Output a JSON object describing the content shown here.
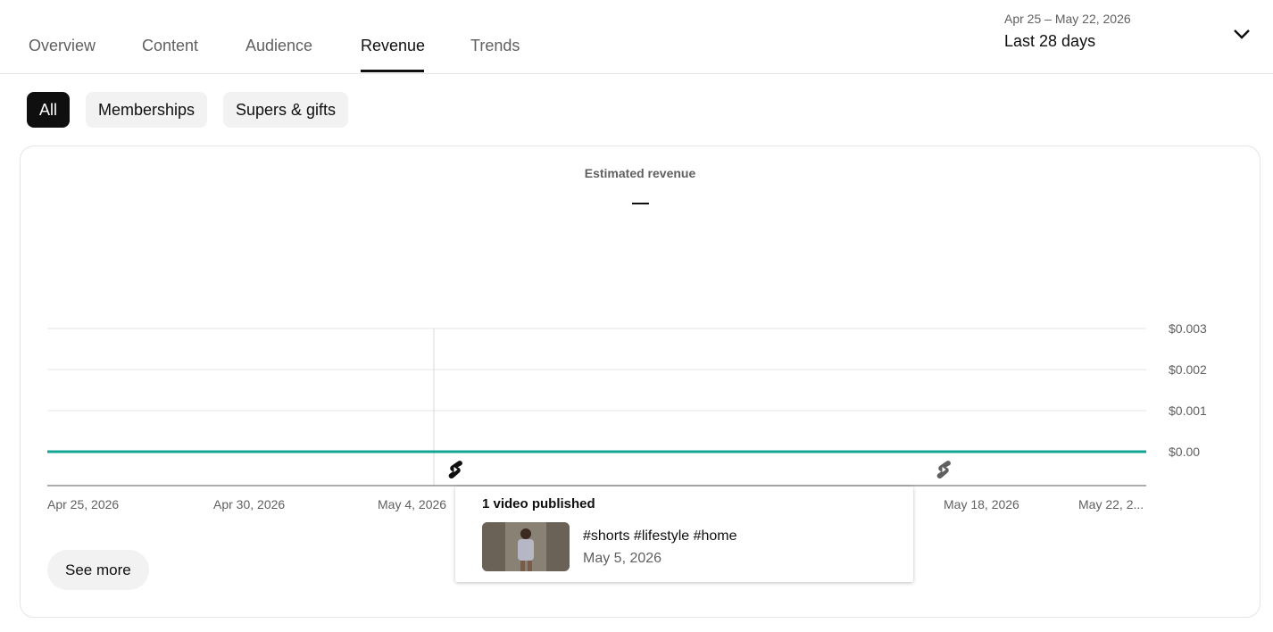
{
  "tabs": [
    {
      "label": "Overview",
      "active": false
    },
    {
      "label": "Content",
      "active": false
    },
    {
      "label": "Audience",
      "active": false
    },
    {
      "label": "Revenue",
      "active": true
    },
    {
      "label": "Trends",
      "active": false
    }
  ],
  "date_picker": {
    "range": "Apr 25 – May 22, 2026",
    "label": "Last 28 days",
    "icon": "chevron-down-icon"
  },
  "filter_chips": [
    {
      "label": "All",
      "selected": true
    },
    {
      "label": "Memberships",
      "selected": false
    },
    {
      "label": "Supers & gifts",
      "selected": false
    }
  ],
  "metric": {
    "title": "Estimated revenue",
    "value": "—"
  },
  "chart_data": {
    "type": "line",
    "title": "Estimated revenue",
    "xlabel": "",
    "ylabel": "",
    "ylim": [
      0,
      0.003
    ],
    "y_ticks": [
      "$0.003",
      "$0.002",
      "$0.001",
      "$0.00"
    ],
    "x_tick_labels": [
      "Apr 25, 2026",
      "Apr 30, 2026",
      "May 4, 2026",
      "May 18, 2026",
      "May 22, 2..."
    ],
    "x": [
      "2026-04-25",
      "2026-04-26",
      "2026-04-27",
      "2026-04-28",
      "2026-04-29",
      "2026-04-30",
      "2026-05-01",
      "2026-05-02",
      "2026-05-03",
      "2026-05-04",
      "2026-05-05",
      "2026-05-06",
      "2026-05-07",
      "2026-05-08",
      "2026-05-09",
      "2026-05-10",
      "2026-05-11",
      "2026-05-12",
      "2026-05-13",
      "2026-05-14",
      "2026-05-15",
      "2026-05-16",
      "2026-05-17",
      "2026-05-18",
      "2026-05-19",
      "2026-05-20",
      "2026-05-21",
      "2026-05-22"
    ],
    "series": [
      {
        "values": [
          0,
          0,
          0,
          0,
          0,
          0,
          0,
          0,
          0,
          0,
          0,
          0,
          0,
          0,
          0,
          0,
          0,
          0,
          0,
          0,
          0,
          0,
          0,
          0,
          0,
          0,
          0,
          0
        ],
        "color": "#12a594"
      }
    ],
    "hover_date": "2026-05-05",
    "publish_markers": [
      "2026-05-05",
      "2026-05-17"
    ],
    "grid": true
  },
  "tooltip": {
    "title": "1 video published",
    "video_title": "#shorts #lifestyle #home",
    "video_date": "May 5, 2026"
  },
  "see_more_label": "See more",
  "colors": {
    "accent_line": "#12a594",
    "text_primary": "#0f0f0f",
    "text_secondary": "#606060",
    "chip_bg": "#f2f2f2"
  }
}
